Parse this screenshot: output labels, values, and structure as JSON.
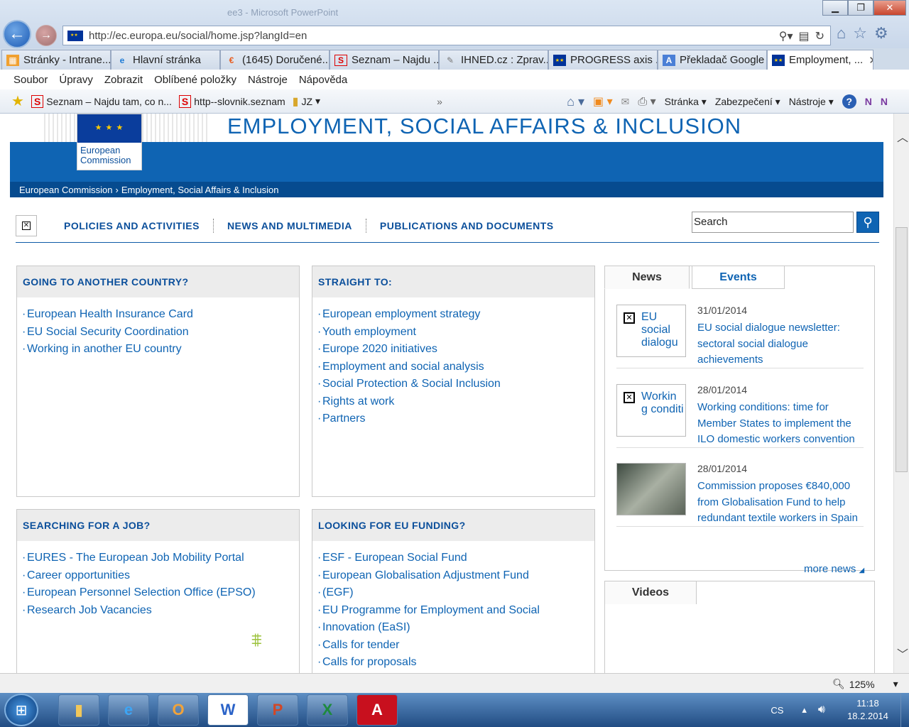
{
  "browser": {
    "title_ghost": "ee3 - Microsoft PowerPoint",
    "url": "http://ec.europa.eu/social/home.jsp?langId=en",
    "tabs": [
      {
        "label": "Stránky - Intrane...",
        "icon": "sharepoint-icon"
      },
      {
        "label": "Hlavní stránka",
        "icon": "ie-icon"
      },
      {
        "label": "(1645) Doručené...",
        "icon": "email-icon"
      },
      {
        "label": "Seznam – Najdu ...",
        "icon": "seznam-icon"
      },
      {
        "label": "IHNED.cz : Zprav...",
        "icon": "ihned-icon"
      },
      {
        "label": "PROGRESS axis ...",
        "icon": "eu-flag-icon"
      },
      {
        "label": "Překladač Google",
        "icon": "translate-icon"
      },
      {
        "label": "Employment, ...",
        "icon": "eu-flag-icon"
      }
    ],
    "menu": [
      "Soubor",
      "Úpravy",
      "Zobrazit",
      "Oblíbené položky",
      "Nástroje",
      "Nápověda"
    ],
    "favorites": [
      {
        "label": "Seznam – Najdu tam, co n...",
        "icon": "seznam-icon"
      },
      {
        "label": "http--slovnik.seznam",
        "icon": "seznam-icon"
      },
      {
        "label": "JZ",
        "icon": "folder-icon"
      }
    ],
    "commands": [
      "Stránka",
      "Zabezpečení",
      "Nástroje"
    ]
  },
  "site": {
    "title": "EMPLOYMENT, SOCIAL AFFAIRS & INCLUSION",
    "logo_text": "European Commission",
    "breadcrumb": [
      "European Commission",
      "Employment, Social Affairs & Inclusion"
    ],
    "nav": [
      "POLICIES AND ACTIVITIES",
      "NEWS AND MULTIMEDIA",
      "PUBLICATIONS AND DOCUMENTS"
    ],
    "search_placeholder": "Search"
  },
  "boxes": [
    {
      "title": "GOING TO ANOTHER COUNTRY?",
      "links": [
        "European Health Insurance Card",
        "EU Social Security Coordination",
        "Working in another EU country"
      ]
    },
    {
      "title": "STRAIGHT TO:",
      "links": [
        "European employment strategy",
        "Youth employment",
        "Europe 2020 initiatives",
        "Employment and social analysis",
        "Social Protection & Social Inclusion",
        "Rights at work",
        "Partners"
      ]
    },
    {
      "title": "SEARCHING FOR A JOB?",
      "links": [
        "EURES - The European Job Mobility Portal",
        "Career opportunities",
        "European Personnel Selection Office (EPSO)",
        "Research Job Vacancies"
      ]
    },
    {
      "title": "LOOKING FOR EU FUNDING?",
      "links": [
        "ESF - European Social Fund",
        "European Globalisation Adjustment Fund",
        "(EGF)",
        "EU Programme for Employment and Social",
        "Innovation (EaSI)",
        "Calls for tender",
        "Calls for proposals"
      ]
    }
  ],
  "news": {
    "tabs": [
      "News",
      "Events"
    ],
    "items": [
      {
        "date": "31/01/2014",
        "thumb": "EU social dialogu",
        "title": "EU social dialogue newsletter: sectoral social dialogue achievements"
      },
      {
        "date": "28/01/2014",
        "thumb": "Workin g conditi",
        "title": "Working conditions: time for Member States to implement the ILO domestic workers convention"
      },
      {
        "date": "28/01/2014",
        "thumb": "",
        "title": "Commission proposes €840,000 from Globalisation Fund to help redundant textile workers in Spain"
      }
    ],
    "more": "more news"
  },
  "videos": {
    "tab": "Videos"
  },
  "status": {
    "zoom": "125%"
  },
  "taskbar": {
    "apps": [
      "explorer-icon",
      "ie-icon",
      "outlook-icon",
      "word-icon",
      "powerpoint-icon",
      "excel-icon",
      "acrobat-icon"
    ],
    "lang": "CS",
    "time": "11:18",
    "date": "18.2.2014"
  }
}
